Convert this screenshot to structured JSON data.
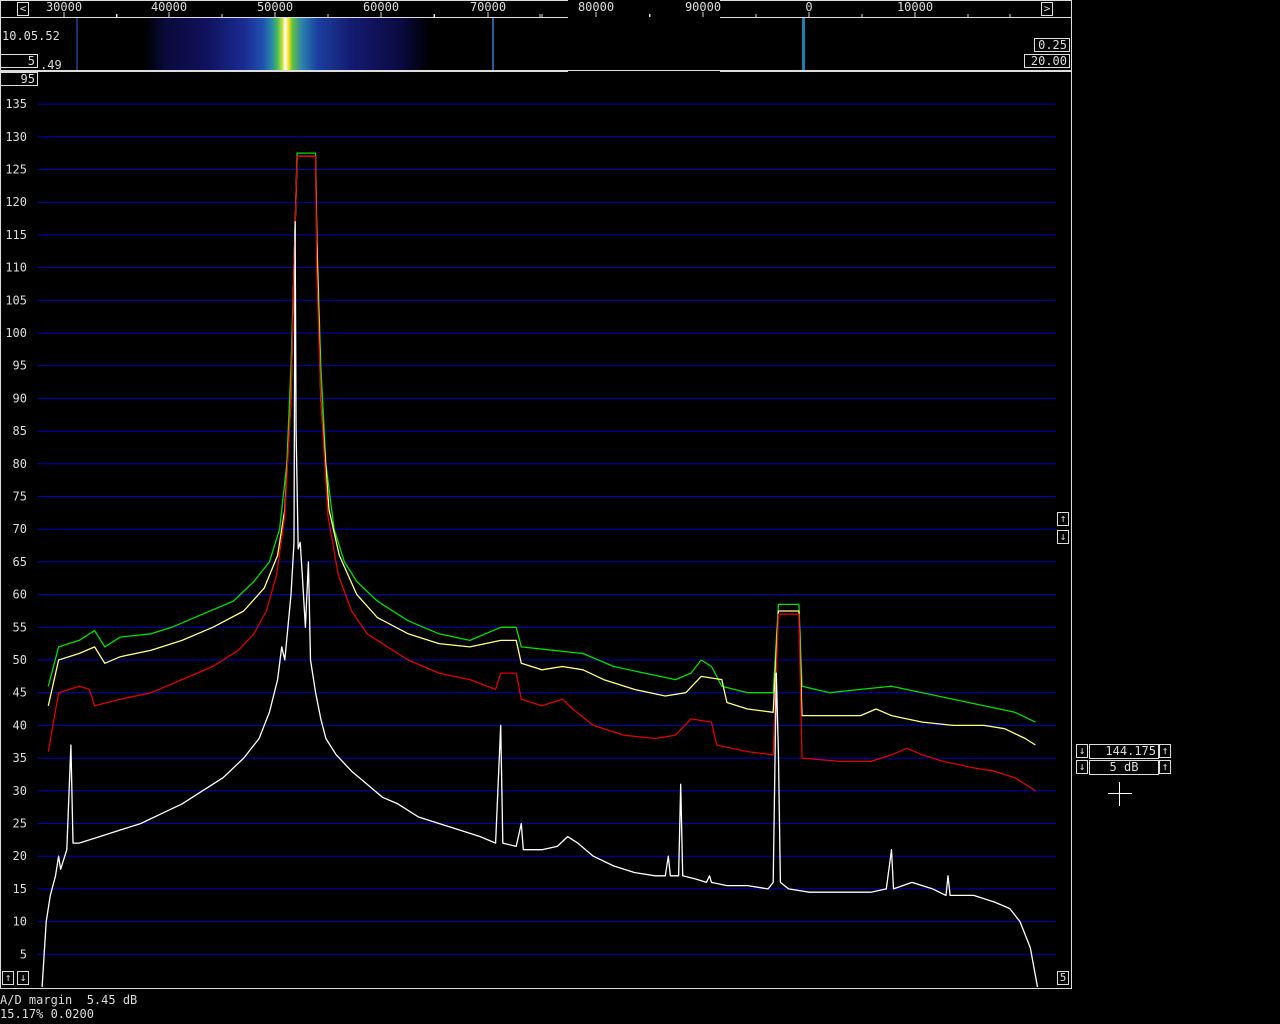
{
  "freq_scale": {
    "left_button": "<",
    "right_button": ">",
    "labels": [
      "30000",
      "40000",
      "50000",
      "60000",
      "70000",
      "80000",
      "90000",
      "0",
      "10000"
    ]
  },
  "waterfall": {
    "time": "10.05.52",
    "avg_count": "5",
    "partial_value": ".49",
    "gain": "0.25",
    "zero_level": "20.00"
  },
  "spectrum": {
    "top_value": "95",
    "y_ticks": [
      5,
      10,
      15,
      20,
      25,
      30,
      35,
      40,
      45,
      50,
      55,
      60,
      65,
      70,
      75,
      80,
      85,
      90,
      95,
      100,
      105,
      110,
      115,
      120,
      125,
      130,
      135
    ],
    "up_button": "↑",
    "down_button": "↓",
    "bottom_right_value": "5"
  },
  "right_panel": {
    "freq_value": "144.175",
    "db_step_value": "5 dB",
    "up": "↑",
    "down": "↓"
  },
  "status": {
    "line1": "A/D margin  5.45 dB",
    "line2": "15.17% 0.0200"
  },
  "colors": {
    "grid": "#0000c0",
    "green": "#00e000",
    "yellow": "#ffff80",
    "red": "#e00000",
    "white": "#ffffff"
  },
  "chart_data": {
    "type": "line",
    "xlim": [
      25000,
      124000
    ],
    "ylim": [
      0,
      138
    ],
    "x_tick_labels": [
      "30000",
      "40000",
      "50000",
      "60000",
      "70000",
      "80000",
      "90000",
      "0",
      "10000"
    ],
    "series": [
      {
        "color": "green",
        "points": [
          [
            26000,
            46
          ],
          [
            27000,
            52
          ],
          [
            29000,
            53
          ],
          [
            30500,
            54.5
          ],
          [
            31500,
            52
          ],
          [
            33000,
            53.5
          ],
          [
            36000,
            54
          ],
          [
            38000,
            55
          ],
          [
            41000,
            57
          ],
          [
            44000,
            59
          ],
          [
            46000,
            62
          ],
          [
            47500,
            65
          ],
          [
            48500,
            70
          ],
          [
            49200,
            80
          ],
          [
            49600,
            95
          ],
          [
            49900,
            110
          ],
          [
            50200,
            127.5
          ],
          [
            52000,
            127.5
          ],
          [
            52100,
            115
          ],
          [
            52500,
            95
          ],
          [
            53000,
            80
          ],
          [
            53800,
            70
          ],
          [
            54800,
            65
          ],
          [
            56000,
            62
          ],
          [
            58000,
            59
          ],
          [
            61000,
            56
          ],
          [
            64000,
            54
          ],
          [
            67000,
            53
          ],
          [
            70000,
            55
          ],
          [
            71500,
            55
          ],
          [
            72000,
            52
          ],
          [
            75000,
            51.5
          ],
          [
            78000,
            51
          ],
          [
            81000,
            49
          ],
          [
            84000,
            48
          ],
          [
            87000,
            47
          ],
          [
            88500,
            48
          ],
          [
            89500,
            50
          ],
          [
            90500,
            49
          ],
          [
            91500,
            46
          ],
          [
            94000,
            45
          ],
          [
            96500,
            45
          ],
          [
            97000,
            58.5
          ],
          [
            99000,
            58.5
          ],
          [
            99300,
            46
          ],
          [
            102000,
            45
          ],
          [
            105000,
            45.5
          ],
          [
            108000,
            46
          ],
          [
            111000,
            45
          ],
          [
            114000,
            44
          ],
          [
            117000,
            43
          ],
          [
            120000,
            42
          ],
          [
            122000,
            40.5
          ]
        ]
      },
      {
        "color": "yellow",
        "points": [
          [
            26000,
            43
          ],
          [
            27000,
            50
          ],
          [
            29000,
            51
          ],
          [
            30500,
            52
          ],
          [
            31500,
            49.5
          ],
          [
            33000,
            50.5
          ],
          [
            36000,
            51.5
          ],
          [
            39000,
            53
          ],
          [
            42000,
            55
          ],
          [
            45000,
            57.5
          ],
          [
            47000,
            61
          ],
          [
            48300,
            66
          ],
          [
            49000,
            73
          ],
          [
            49600,
            90
          ],
          [
            49900,
            110
          ],
          [
            50200,
            127
          ],
          [
            52000,
            127
          ],
          [
            52100,
            115
          ],
          [
            52500,
            90
          ],
          [
            53300,
            73
          ],
          [
            54300,
            66
          ],
          [
            56000,
            60
          ],
          [
            58000,
            56.5
          ],
          [
            61000,
            54
          ],
          [
            64000,
            52.5
          ],
          [
            67000,
            52
          ],
          [
            70000,
            53
          ],
          [
            71500,
            53
          ],
          [
            72000,
            49.5
          ],
          [
            74000,
            48.5
          ],
          [
            76000,
            49
          ],
          [
            78000,
            48.5
          ],
          [
            80000,
            47
          ],
          [
            83000,
            45.5
          ],
          [
            86000,
            44.5
          ],
          [
            88000,
            45
          ],
          [
            89500,
            47.5
          ],
          [
            91500,
            47
          ],
          [
            92000,
            43.5
          ],
          [
            94000,
            42.5
          ],
          [
            96500,
            42
          ],
          [
            97000,
            57.5
          ],
          [
            99000,
            57.5
          ],
          [
            99300,
            41.5
          ],
          [
            103000,
            41.5
          ],
          [
            105000,
            41.5
          ],
          [
            106500,
            42.5
          ],
          [
            108000,
            41.5
          ],
          [
            111000,
            40.5
          ],
          [
            114000,
            40
          ],
          [
            117000,
            40
          ],
          [
            119000,
            39.5
          ],
          [
            121000,
            38
          ],
          [
            122000,
            37
          ]
        ]
      },
      {
        "color": "red",
        "points": [
          [
            26000,
            36
          ],
          [
            27000,
            45
          ],
          [
            29000,
            46
          ],
          [
            30000,
            45.5
          ],
          [
            30500,
            43
          ],
          [
            33000,
            44
          ],
          [
            36000,
            45
          ],
          [
            39000,
            47
          ],
          [
            42000,
            49
          ],
          [
            44500,
            51.5
          ],
          [
            46000,
            54
          ],
          [
            47200,
            57.5
          ],
          [
            48200,
            63
          ],
          [
            49000,
            72
          ],
          [
            49600,
            90
          ],
          [
            49900,
            110
          ],
          [
            50200,
            127
          ],
          [
            52000,
            127
          ],
          [
            52100,
            110
          ],
          [
            52500,
            90
          ],
          [
            53200,
            72
          ],
          [
            54200,
            63
          ],
          [
            55500,
            57.5
          ],
          [
            57000,
            54
          ],
          [
            59000,
            52
          ],
          [
            61000,
            50
          ],
          [
            64000,
            48
          ],
          [
            67000,
            47
          ],
          [
            69500,
            45.5
          ],
          [
            70000,
            48
          ],
          [
            71500,
            48
          ],
          [
            72000,
            44
          ],
          [
            74000,
            43
          ],
          [
            76000,
            44
          ],
          [
            77000,
            42.5
          ],
          [
            79000,
            40
          ],
          [
            82000,
            38.5
          ],
          [
            85000,
            38
          ],
          [
            87000,
            38.5
          ],
          [
            88500,
            41
          ],
          [
            90500,
            40.5
          ],
          [
            91000,
            37
          ],
          [
            94000,
            36
          ],
          [
            96500,
            35.5
          ],
          [
            97000,
            57
          ],
          [
            99000,
            57
          ],
          [
            99300,
            35
          ],
          [
            103000,
            34.5
          ],
          [
            106000,
            34.5
          ],
          [
            108000,
            35.5
          ],
          [
            109500,
            36.5
          ],
          [
            111000,
            35.5
          ],
          [
            113000,
            34.5
          ],
          [
            116000,
            33.5
          ],
          [
            118000,
            33
          ],
          [
            120000,
            32
          ],
          [
            122000,
            30
          ]
        ]
      },
      {
        "color": "white",
        "points": [
          [
            25400,
            0
          ],
          [
            25800,
            10
          ],
          [
            26200,
            14
          ],
          [
            26700,
            17
          ],
          [
            27000,
            20
          ],
          [
            27200,
            18
          ],
          [
            27800,
            21
          ],
          [
            28200,
            37
          ],
          [
            28400,
            22
          ],
          [
            29000,
            22
          ],
          [
            31000,
            23
          ],
          [
            33000,
            24
          ],
          [
            35000,
            25
          ],
          [
            37000,
            26.5
          ],
          [
            39000,
            28
          ],
          [
            41000,
            30
          ],
          [
            43000,
            32
          ],
          [
            45000,
            35
          ],
          [
            46500,
            38
          ],
          [
            47500,
            42
          ],
          [
            48300,
            47
          ],
          [
            48700,
            52
          ],
          [
            49000,
            50
          ],
          [
            49300,
            55
          ],
          [
            49600,
            60
          ],
          [
            49900,
            68
          ],
          [
            50000,
            117
          ],
          [
            50100,
            85
          ],
          [
            50300,
            67
          ],
          [
            50500,
            68
          ],
          [
            50700,
            63
          ],
          [
            51000,
            55
          ],
          [
            51300,
            65
          ],
          [
            51500,
            50
          ],
          [
            52000,
            45
          ],
          [
            52500,
            41
          ],
          [
            53000,
            38
          ],
          [
            54000,
            35.5
          ],
          [
            55500,
            33
          ],
          [
            57000,
            31
          ],
          [
            58500,
            29
          ],
          [
            60000,
            28
          ],
          [
            62000,
            26
          ],
          [
            64000,
            25
          ],
          [
            66000,
            24
          ],
          [
            68000,
            23
          ],
          [
            69500,
            22
          ],
          [
            70000,
            40
          ],
          [
            70200,
            22
          ],
          [
            71500,
            21.5
          ],
          [
            72000,
            25
          ],
          [
            72200,
            21
          ],
          [
            74000,
            21
          ],
          [
            75500,
            21.5
          ],
          [
            76500,
            23
          ],
          [
            77500,
            22
          ],
          [
            79000,
            20
          ],
          [
            81000,
            18.5
          ],
          [
            83000,
            17.5
          ],
          [
            85000,
            17
          ],
          [
            86000,
            17
          ],
          [
            86300,
            20
          ],
          [
            86500,
            17
          ],
          [
            87300,
            17
          ],
          [
            87500,
            31
          ],
          [
            87700,
            17
          ],
          [
            89000,
            16.5
          ],
          [
            90000,
            16
          ],
          [
            90300,
            17
          ],
          [
            90500,
            16
          ],
          [
            92000,
            15.5
          ],
          [
            94000,
            15.5
          ],
          [
            96000,
            15
          ],
          [
            96500,
            16
          ],
          [
            96800,
            48
          ],
          [
            97000,
            36
          ],
          [
            97200,
            16
          ],
          [
            98000,
            15
          ],
          [
            100000,
            14.5
          ],
          [
            102000,
            14.5
          ],
          [
            104000,
            14.5
          ],
          [
            106000,
            14.5
          ],
          [
            107500,
            15
          ],
          [
            108000,
            21
          ],
          [
            108200,
            15
          ],
          [
            110000,
            16
          ],
          [
            112000,
            15
          ],
          [
            113300,
            14
          ],
          [
            113500,
            17
          ],
          [
            113700,
            14
          ],
          [
            116000,
            14
          ],
          [
            118000,
            13
          ],
          [
            119500,
            12
          ],
          [
            120500,
            10
          ],
          [
            121500,
            6
          ],
          [
            122200,
            0
          ]
        ]
      }
    ]
  }
}
